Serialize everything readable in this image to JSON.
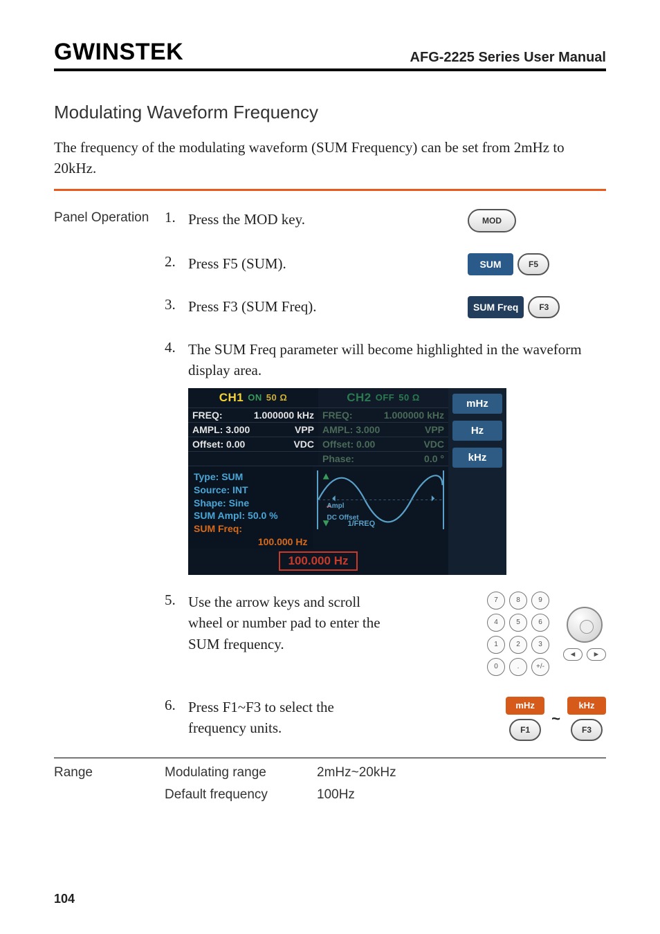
{
  "header": {
    "logo": "GWINSTEK",
    "doc_title": "AFG-2225 Series User Manual"
  },
  "section": {
    "title": "Modulating Waveform Frequency",
    "intro": "The frequency of the modulating waveform (SUM Frequency) can be set from 2mHz to 20kHz."
  },
  "left_labels": {
    "panel_op": "Panel Operation",
    "range": "Range"
  },
  "steps": {
    "s1": {
      "num": "1.",
      "text": "Press the MOD key.",
      "btn": "MOD"
    },
    "s2": {
      "num": "2.",
      "text": "Press F5 (SUM).",
      "soft": "SUM",
      "key": "F5"
    },
    "s3": {
      "num": "3.",
      "text": "Press F3 (SUM Freq).",
      "soft": "SUM Freq",
      "key": "F3"
    },
    "s4": {
      "num": "4.",
      "text": "The SUM Freq parameter will  become highlighted in the waveform display area."
    },
    "s5": {
      "num": "5.",
      "text": "Use the arrow keys and scroll wheel or number pad to enter the SUM frequency."
    },
    "s6": {
      "num": "6.",
      "text": "Press F1~F3 to select the frequency units.",
      "soft_a": "mHz",
      "key_a": "F1",
      "soft_b": "kHz",
      "key_b": "F3"
    }
  },
  "device": {
    "ch1": {
      "name": "CH1",
      "state": "ON",
      "imp": "50 Ω"
    },
    "ch2": {
      "name": "CH2",
      "state": "OFF",
      "imp": "50 Ω"
    },
    "ch1_freq_l": "FREQ:",
    "ch1_freq_v": "1.000000 kHz",
    "ch2_freq_l": "FREQ:",
    "ch2_freq_v": "1.000000 kHz",
    "ch1_ampl_l": "AMPL:",
    "ch1_ampl_v": "3.000",
    "ch1_ampl_u": "VPP",
    "ch2_ampl_l": "AMPL:",
    "ch2_ampl_v": "3.000",
    "ch2_ampl_u": "VPP",
    "ch1_off_l": "Offset:",
    "ch1_off_v": "0.00",
    "ch1_off_u": "VDC",
    "ch2_off_l": "Offset:",
    "ch2_off_v": "0.00",
    "ch2_off_u": "VDC",
    "ch2_phase_l": "Phase:",
    "ch2_phase_v": "0.0 °",
    "mod": {
      "type": "Type: SUM",
      "source": "Source: INT",
      "shape": "Shape: Sine",
      "sum_ampl": "SUM Ampl:  50.0 %",
      "sum_freq_l": "SUM Freq:",
      "sum_freq_v": "100.000  Hz"
    },
    "wave": {
      "ampl": "Ampl",
      "dcoffset": "DC Offset",
      "freq": "1/FREQ"
    },
    "value_box": "100.000  Hz",
    "side": {
      "mhz": "mHz",
      "hz": "Hz",
      "khz": "kHz"
    }
  },
  "keypad": [
    "7",
    "8",
    "9",
    "4",
    "5",
    "6",
    "1",
    "2",
    "3",
    "0",
    ".",
    "+/-"
  ],
  "range": {
    "mod_range_l": "Modulating range",
    "mod_range_v": "2mHz~20kHz",
    "def_freq_l": "Default frequency",
    "def_freq_v": "100Hz"
  },
  "page_number": "104"
}
